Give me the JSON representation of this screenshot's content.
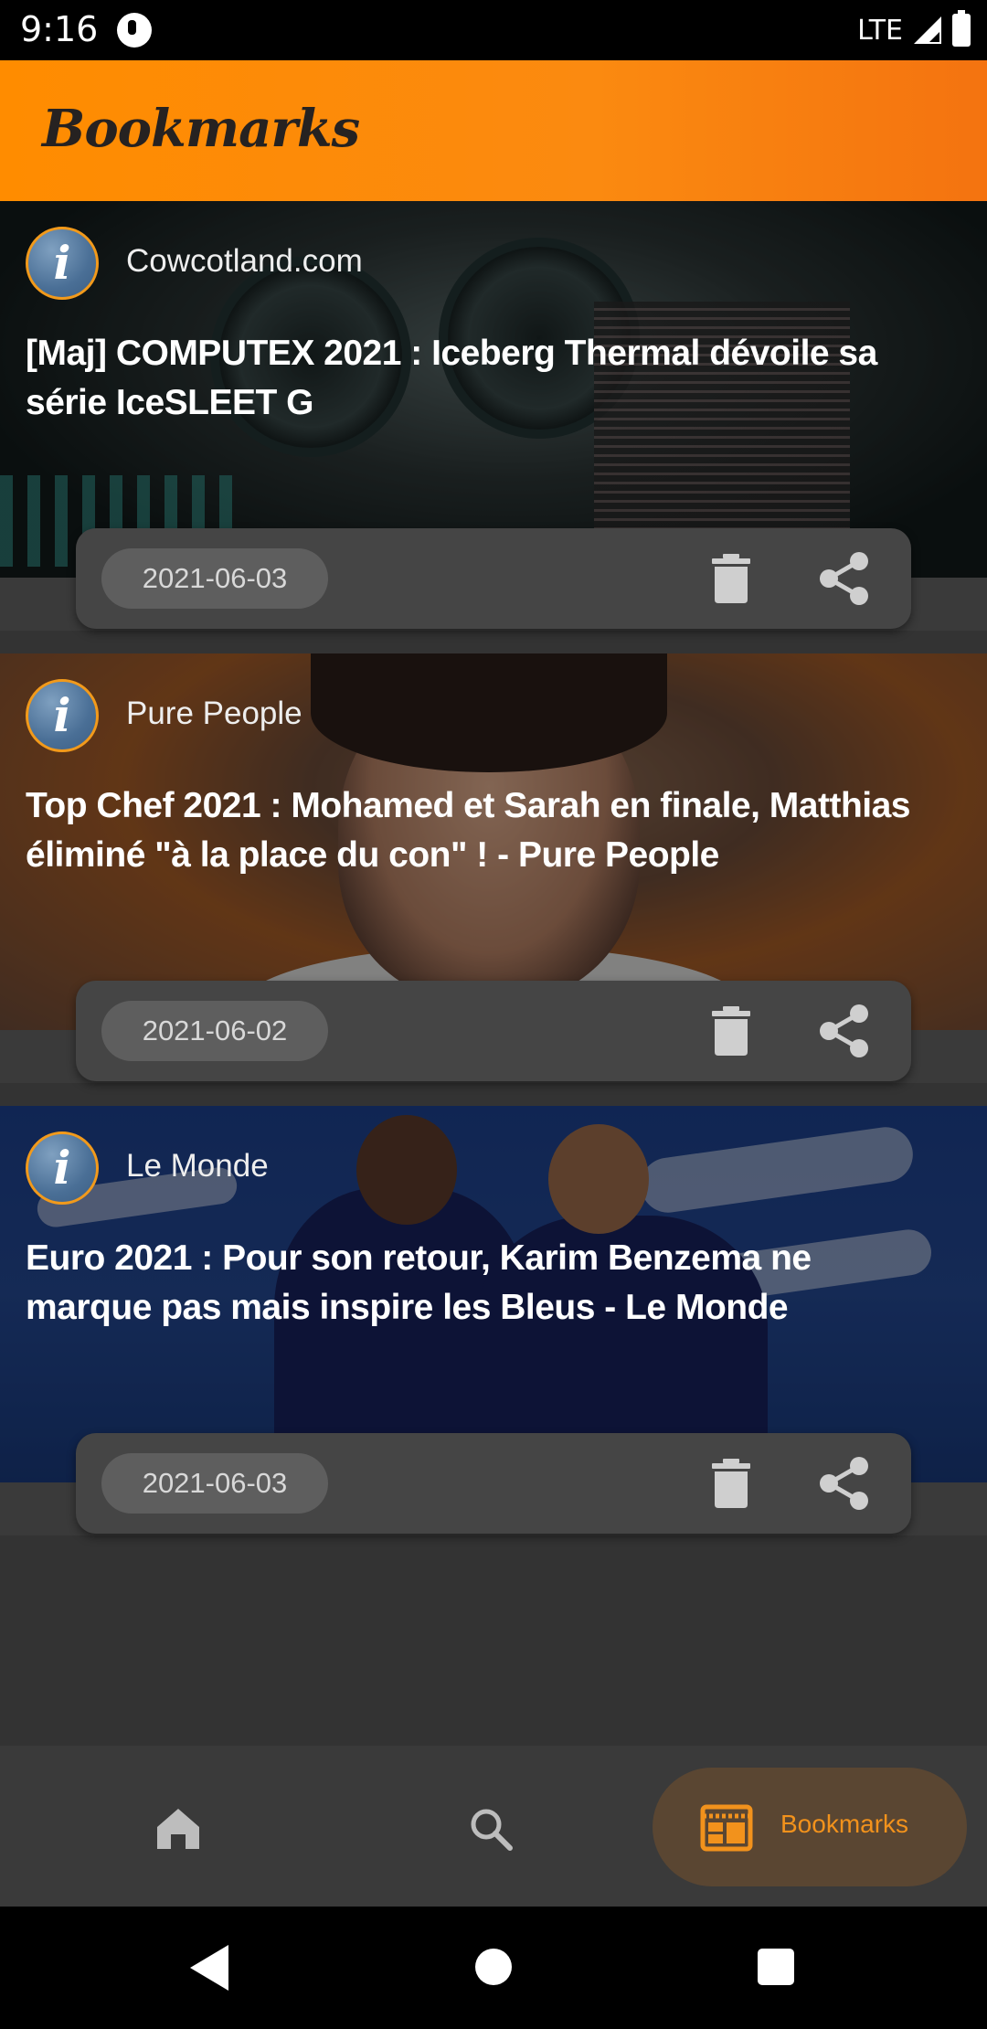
{
  "status_bar": {
    "time": "9:16",
    "network": "LTE"
  },
  "app_bar": {
    "title": "Bookmarks"
  },
  "cards": [
    {
      "source": "Cowcotland.com",
      "headline": "[Maj] COMPUTEX 2021 : Iceberg Thermal dévoile sa série IceSLEET G",
      "date": "2021-06-03"
    },
    {
      "source": "Pure People",
      "headline": "Top Chef 2021 : Mohamed et Sarah en finale, Matthias éliminé \"à la place du con\" ! - Pure People",
      "date": "2021-06-02"
    },
    {
      "source": "Le Monde",
      "headline": "Euro 2021 : Pour son retour, Karim Benzema ne marque pas mais inspire les Bleus - Le Monde",
      "date": "2021-06-03"
    }
  ],
  "bottom_nav": {
    "items": [
      {
        "icon": "home-icon"
      },
      {
        "icon": "search-icon"
      },
      {
        "icon": "bookmarks-icon",
        "label": "Bookmarks",
        "active": true
      }
    ]
  },
  "colors": {
    "accent": "#f2921c",
    "app_bar_start": "#ff8c00",
    "app_bar_end": "#f47310",
    "background": "#333333",
    "card_action_bar": "#454545",
    "date_chip": "#5e5e5e"
  },
  "icons": {
    "delete": "trash-icon",
    "share": "share-icon",
    "source": "info-icon",
    "system_nav": [
      "back-icon",
      "home-circle-icon",
      "recents-icon"
    ]
  }
}
